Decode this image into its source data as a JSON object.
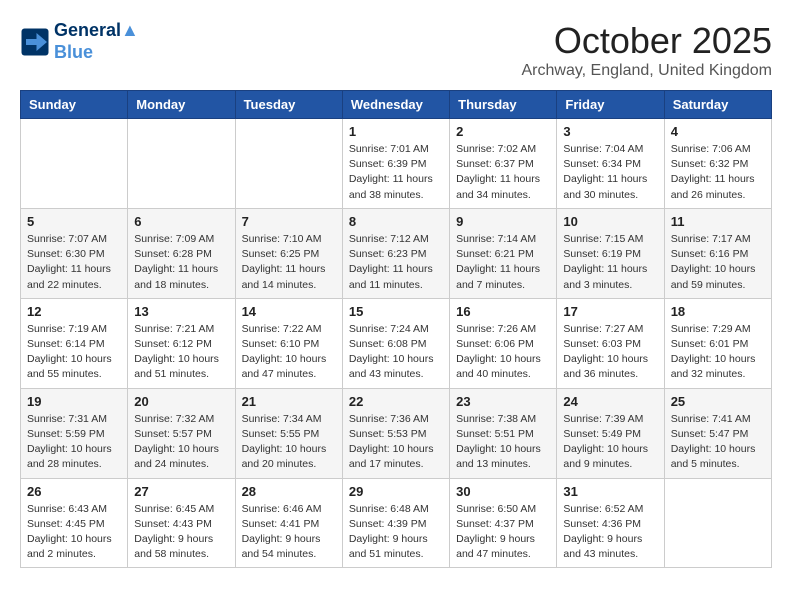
{
  "header": {
    "logo_line1": "General",
    "logo_line2": "Blue",
    "month": "October 2025",
    "location": "Archway, England, United Kingdom"
  },
  "weekdays": [
    "Sunday",
    "Monday",
    "Tuesday",
    "Wednesday",
    "Thursday",
    "Friday",
    "Saturday"
  ],
  "weeks": [
    [
      {
        "day": "",
        "content": ""
      },
      {
        "day": "",
        "content": ""
      },
      {
        "day": "",
        "content": ""
      },
      {
        "day": "1",
        "content": "Sunrise: 7:01 AM\nSunset: 6:39 PM\nDaylight: 11 hours\nand 38 minutes."
      },
      {
        "day": "2",
        "content": "Sunrise: 7:02 AM\nSunset: 6:37 PM\nDaylight: 11 hours\nand 34 minutes."
      },
      {
        "day": "3",
        "content": "Sunrise: 7:04 AM\nSunset: 6:34 PM\nDaylight: 11 hours\nand 30 minutes."
      },
      {
        "day": "4",
        "content": "Sunrise: 7:06 AM\nSunset: 6:32 PM\nDaylight: 11 hours\nand 26 minutes."
      }
    ],
    [
      {
        "day": "5",
        "content": "Sunrise: 7:07 AM\nSunset: 6:30 PM\nDaylight: 11 hours\nand 22 minutes."
      },
      {
        "day": "6",
        "content": "Sunrise: 7:09 AM\nSunset: 6:28 PM\nDaylight: 11 hours\nand 18 minutes."
      },
      {
        "day": "7",
        "content": "Sunrise: 7:10 AM\nSunset: 6:25 PM\nDaylight: 11 hours\nand 14 minutes."
      },
      {
        "day": "8",
        "content": "Sunrise: 7:12 AM\nSunset: 6:23 PM\nDaylight: 11 hours\nand 11 minutes."
      },
      {
        "day": "9",
        "content": "Sunrise: 7:14 AM\nSunset: 6:21 PM\nDaylight: 11 hours\nand 7 minutes."
      },
      {
        "day": "10",
        "content": "Sunrise: 7:15 AM\nSunset: 6:19 PM\nDaylight: 11 hours\nand 3 minutes."
      },
      {
        "day": "11",
        "content": "Sunrise: 7:17 AM\nSunset: 6:16 PM\nDaylight: 10 hours\nand 59 minutes."
      }
    ],
    [
      {
        "day": "12",
        "content": "Sunrise: 7:19 AM\nSunset: 6:14 PM\nDaylight: 10 hours\nand 55 minutes."
      },
      {
        "day": "13",
        "content": "Sunrise: 7:21 AM\nSunset: 6:12 PM\nDaylight: 10 hours\nand 51 minutes."
      },
      {
        "day": "14",
        "content": "Sunrise: 7:22 AM\nSunset: 6:10 PM\nDaylight: 10 hours\nand 47 minutes."
      },
      {
        "day": "15",
        "content": "Sunrise: 7:24 AM\nSunset: 6:08 PM\nDaylight: 10 hours\nand 43 minutes."
      },
      {
        "day": "16",
        "content": "Sunrise: 7:26 AM\nSunset: 6:06 PM\nDaylight: 10 hours\nand 40 minutes."
      },
      {
        "day": "17",
        "content": "Sunrise: 7:27 AM\nSunset: 6:03 PM\nDaylight: 10 hours\nand 36 minutes."
      },
      {
        "day": "18",
        "content": "Sunrise: 7:29 AM\nSunset: 6:01 PM\nDaylight: 10 hours\nand 32 minutes."
      }
    ],
    [
      {
        "day": "19",
        "content": "Sunrise: 7:31 AM\nSunset: 5:59 PM\nDaylight: 10 hours\nand 28 minutes."
      },
      {
        "day": "20",
        "content": "Sunrise: 7:32 AM\nSunset: 5:57 PM\nDaylight: 10 hours\nand 24 minutes."
      },
      {
        "day": "21",
        "content": "Sunrise: 7:34 AM\nSunset: 5:55 PM\nDaylight: 10 hours\nand 20 minutes."
      },
      {
        "day": "22",
        "content": "Sunrise: 7:36 AM\nSunset: 5:53 PM\nDaylight: 10 hours\nand 17 minutes."
      },
      {
        "day": "23",
        "content": "Sunrise: 7:38 AM\nSunset: 5:51 PM\nDaylight: 10 hours\nand 13 minutes."
      },
      {
        "day": "24",
        "content": "Sunrise: 7:39 AM\nSunset: 5:49 PM\nDaylight: 10 hours\nand 9 minutes."
      },
      {
        "day": "25",
        "content": "Sunrise: 7:41 AM\nSunset: 5:47 PM\nDaylight: 10 hours\nand 5 minutes."
      }
    ],
    [
      {
        "day": "26",
        "content": "Sunrise: 6:43 AM\nSunset: 4:45 PM\nDaylight: 10 hours\nand 2 minutes."
      },
      {
        "day": "27",
        "content": "Sunrise: 6:45 AM\nSunset: 4:43 PM\nDaylight: 9 hours\nand 58 minutes."
      },
      {
        "day": "28",
        "content": "Sunrise: 6:46 AM\nSunset: 4:41 PM\nDaylight: 9 hours\nand 54 minutes."
      },
      {
        "day": "29",
        "content": "Sunrise: 6:48 AM\nSunset: 4:39 PM\nDaylight: 9 hours\nand 51 minutes."
      },
      {
        "day": "30",
        "content": "Sunrise: 6:50 AM\nSunset: 4:37 PM\nDaylight: 9 hours\nand 47 minutes."
      },
      {
        "day": "31",
        "content": "Sunrise: 6:52 AM\nSunset: 4:36 PM\nDaylight: 9 hours\nand 43 minutes."
      },
      {
        "day": "",
        "content": ""
      }
    ]
  ]
}
